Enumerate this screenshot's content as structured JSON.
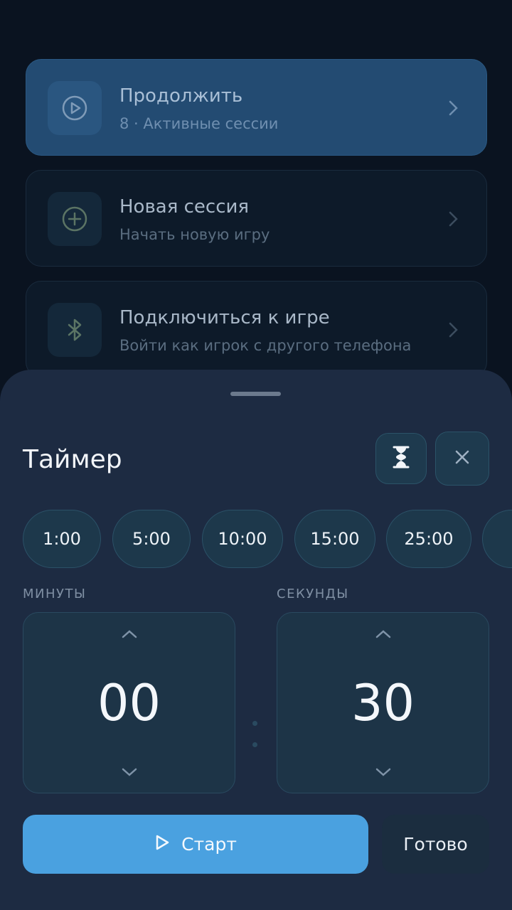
{
  "menu": {
    "items": [
      {
        "title": "Продолжить",
        "subtitle": "8 · Активные сессии",
        "icon": "play-circle-icon"
      },
      {
        "title": "Новая сессия",
        "subtitle": "Начать новую игру",
        "icon": "plus-circle-icon"
      },
      {
        "title": "Подключиться к игре",
        "subtitle": "Войти как игрок с другого телефона",
        "icon": "bluetooth-icon"
      }
    ]
  },
  "sheet": {
    "title": "Таймер",
    "presets": [
      "1:00",
      "5:00",
      "10:00",
      "15:00",
      "25:00"
    ],
    "minutes_label": "МИНУТЫ",
    "seconds_label": "СЕКУНДЫ",
    "minutes_value": "00",
    "seconds_value": "30",
    "start_label": "Старт",
    "done_label": "Готово"
  },
  "colors": {
    "accent": "#4aa1e0",
    "sheet_bg": "#1d2b42",
    "page_bg": "#0a1320"
  }
}
